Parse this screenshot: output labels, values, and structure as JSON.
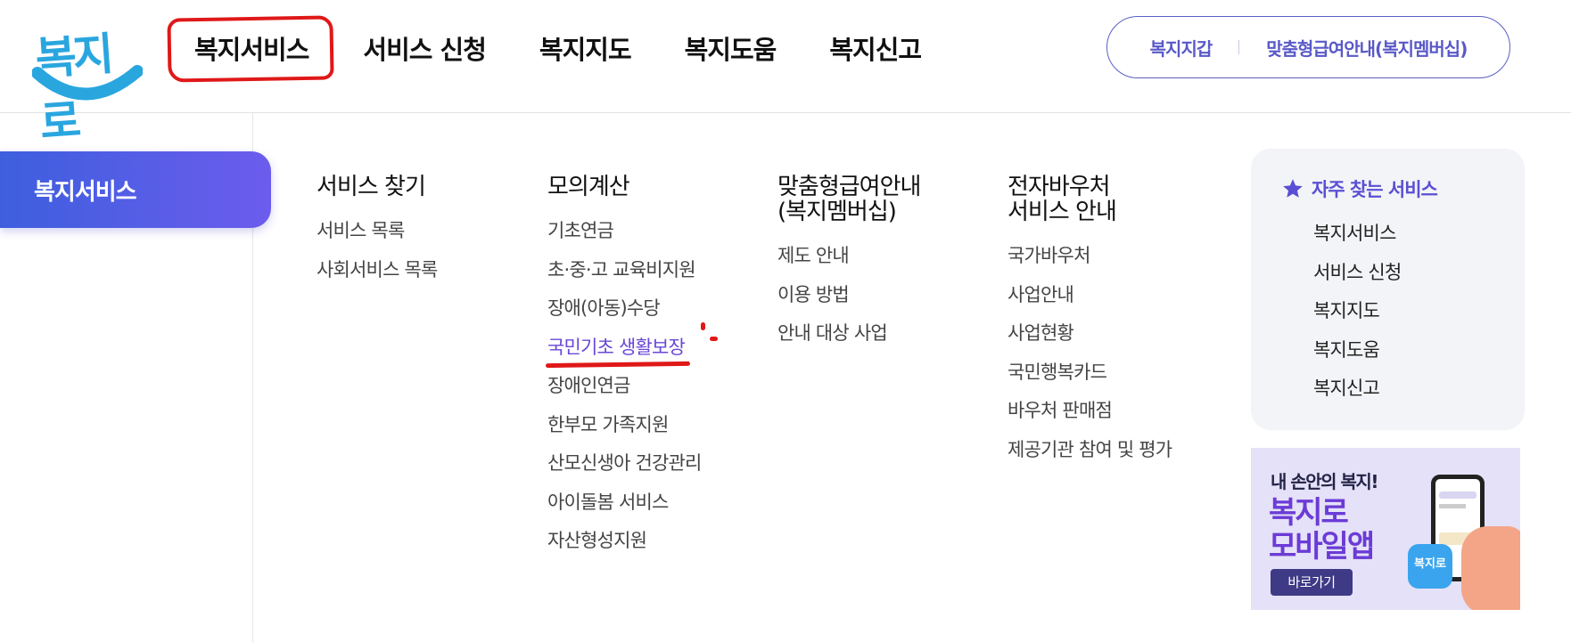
{
  "logo": {
    "text": "복지로"
  },
  "gnb": {
    "items": [
      "복지서비스",
      "서비스 신청",
      "복지지도",
      "복지도움",
      "복지신고"
    ]
  },
  "util": {
    "wallet": "복지지갑",
    "membership": "맞춤형급여안내(복지멤버십)"
  },
  "side": {
    "active_tab": "복지서비스"
  },
  "columns": {
    "search": {
      "title": "서비스 찾기",
      "items": [
        "서비스 목록",
        "사회서비스 목록"
      ]
    },
    "simulation": {
      "title": "모의계산",
      "items": [
        "기초연금",
        "초·중·고 교육비지원",
        "장애(아동)수당",
        "국민기초 생활보장",
        "장애인연금",
        "한부모 가족지원",
        "산모신생아 건강관리",
        "아이돌봄 서비스",
        "자산형성지원"
      ],
      "active_index": 3
    },
    "membership": {
      "title_line1": "맞춤형급여안내",
      "title_line2": "(복지멤버십)",
      "items": [
        "제도 안내",
        "이용 방법",
        "안내 대상 사업"
      ]
    },
    "voucher": {
      "title_line1": "전자바우처",
      "title_line2": "서비스 안내",
      "items": [
        "국가바우처",
        "사업안내",
        "사업현황",
        "국민행복카드",
        "바우처 판매점",
        "제공기관 참여 및 평가"
      ]
    }
  },
  "favorites": {
    "title": "자주 찾는 서비스",
    "items": [
      "복지서비스",
      "서비스 신청",
      "복지지도",
      "복지도움",
      "복지신고"
    ]
  },
  "banner": {
    "small": "내 손안의 복지!",
    "big1": "복지로",
    "big2": "모바일앱",
    "button": "바로가기",
    "app_icon_text": "복지로"
  },
  "colors": {
    "accent": "#6a47d6",
    "brand_blue": "#2aa6df",
    "annotation_red": "#e01818"
  }
}
